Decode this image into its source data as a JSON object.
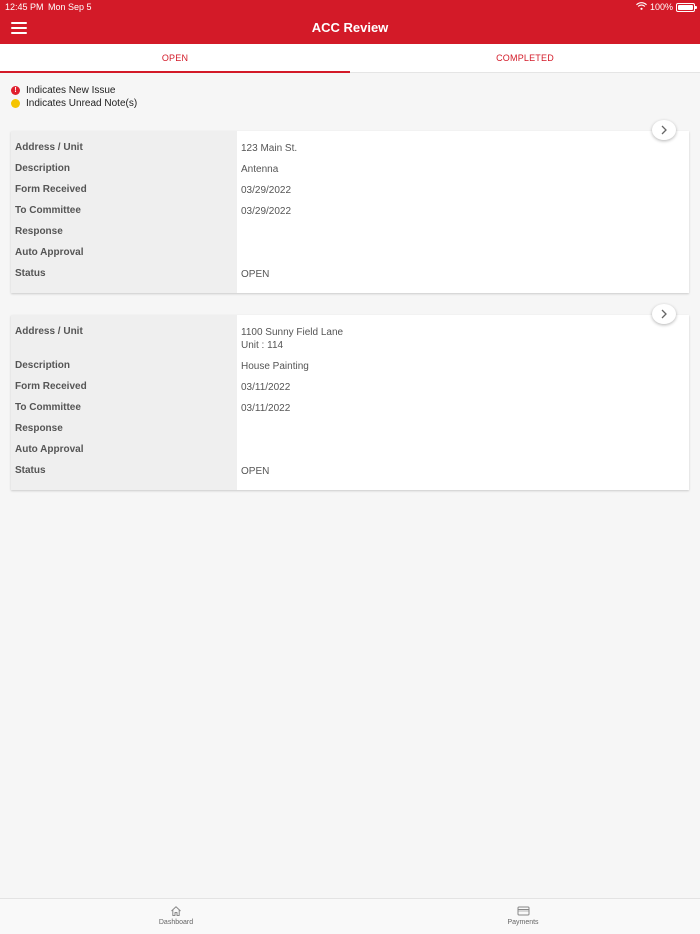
{
  "status_bar": {
    "time": "12:45 PM",
    "date": "Mon Sep 5",
    "battery": "100%"
  },
  "header": {
    "title": "ACC Review"
  },
  "tabs": [
    {
      "label": "OPEN",
      "active": true
    },
    {
      "label": "COMPLETED",
      "active": false
    }
  ],
  "legend": {
    "new_issue": "Indicates New Issue",
    "new_issue_icon": "!",
    "unread_notes": "Indicates Unread Note(s)"
  },
  "labels": {
    "address": "Address / Unit",
    "description": "Description",
    "form_received": "Form Received",
    "to_committee": "To Committee",
    "response": "Response",
    "auto_approval": "Auto Approval",
    "status": "Status"
  },
  "cards": [
    {
      "address": "123 Main St.",
      "unit": "",
      "description": "Antenna",
      "form_received": "03/29/2022",
      "to_committee": "03/29/2022",
      "response": "",
      "auto_approval": "",
      "status": "OPEN"
    },
    {
      "address": "1100 Sunny Field Lane",
      "unit": "Unit : 114",
      "description": "House Painting",
      "form_received": "03/11/2022",
      "to_committee": "03/11/2022",
      "response": "",
      "auto_approval": "",
      "status": "OPEN"
    }
  ],
  "bottom_nav": [
    {
      "label": "Dashboard",
      "icon": "home-icon"
    },
    {
      "label": "Payments",
      "icon": "card-icon"
    }
  ],
  "colors": {
    "brand": "#d31a28",
    "new_issue": "#e0202e",
    "unread_note": "#f5c400"
  }
}
